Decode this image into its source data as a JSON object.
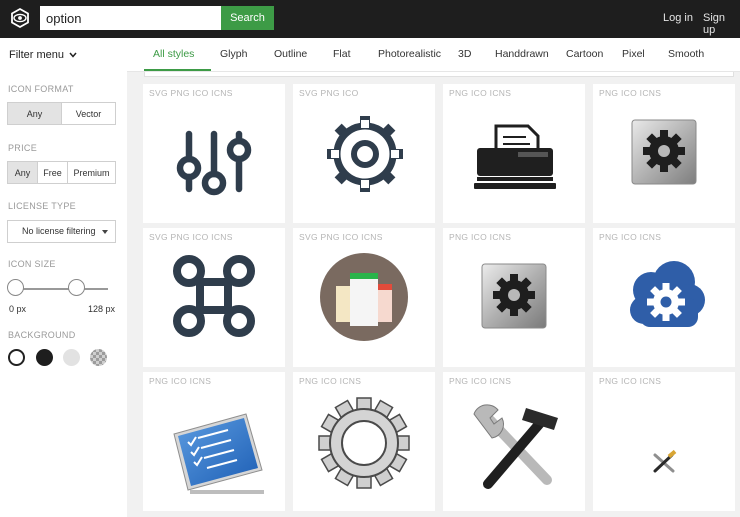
{
  "header": {
    "search": {
      "value": "option",
      "button_label": "Search"
    },
    "login_label": "Log in",
    "signup_label": "Sign up"
  },
  "sidebar": {
    "filter_menu_label": "Filter menu",
    "icon_format": {
      "label": "ICON FORMAT",
      "options": [
        "Any",
        "Vector"
      ],
      "selected": "Any"
    },
    "price": {
      "label": "PRICE",
      "options": [
        "Any",
        "Free",
        "Premium"
      ],
      "selected": "Any"
    },
    "license_type": {
      "label": "LICENSE TYPE",
      "selected": "No license filtering"
    },
    "icon_size": {
      "label": "ICON SIZE",
      "min_label": "0 px",
      "max_label": "128 px"
    },
    "background": {
      "label": "BACKGROUND",
      "swatches": [
        "white",
        "black",
        "light-gray",
        "checkerboard"
      ]
    }
  },
  "tabs": [
    "All styles",
    "Glyph",
    "Outline",
    "Flat",
    "Photorealistic",
    "3D",
    "Handdrawn",
    "Cartoon",
    "Pixel",
    "Smooth"
  ],
  "active_tab": "All styles",
  "colors": {
    "accent": "#3d9b46",
    "topbar": "#1e1e1e",
    "icon_dark": "#2f3d4c",
    "cloud_blue": "#2f5ea8",
    "flat_circle": "#7a6a60"
  },
  "results": [
    {
      "formats": "SVG  PNG  ICO  ICNS",
      "icon": "settings-sliders-icon"
    },
    {
      "formats": "SVG  PNG  ICO",
      "icon": "gear-outline-icon"
    },
    {
      "formats": "PNG  ICO  ICNS",
      "icon": "printer-fax-icon"
    },
    {
      "formats": "PNG  ICO  ICNS",
      "icon": "metal-gear-button-icon"
    },
    {
      "formats": "SVG  PNG  ICO  ICNS",
      "icon": "command-key-icon"
    },
    {
      "formats": "SVG  PNG  ICO  ICNS",
      "icon": "flat-documents-icon"
    },
    {
      "formats": "PNG  ICO  ICNS",
      "icon": "metal-gear-button-icon"
    },
    {
      "formats": "PNG  ICO  ICNS",
      "icon": "cloud-gear-icon"
    },
    {
      "formats": "PNG  ICO  ICNS",
      "icon": "checklist-monitor-icon"
    },
    {
      "formats": "PNG  ICO  ICNS",
      "icon": "sketch-gear-icon"
    },
    {
      "formats": "PNG  ICO  ICNS",
      "icon": "wrench-hammer-icon"
    },
    {
      "formats": "PNG  ICO  ICNS",
      "icon": "small-tools-icon"
    }
  ]
}
